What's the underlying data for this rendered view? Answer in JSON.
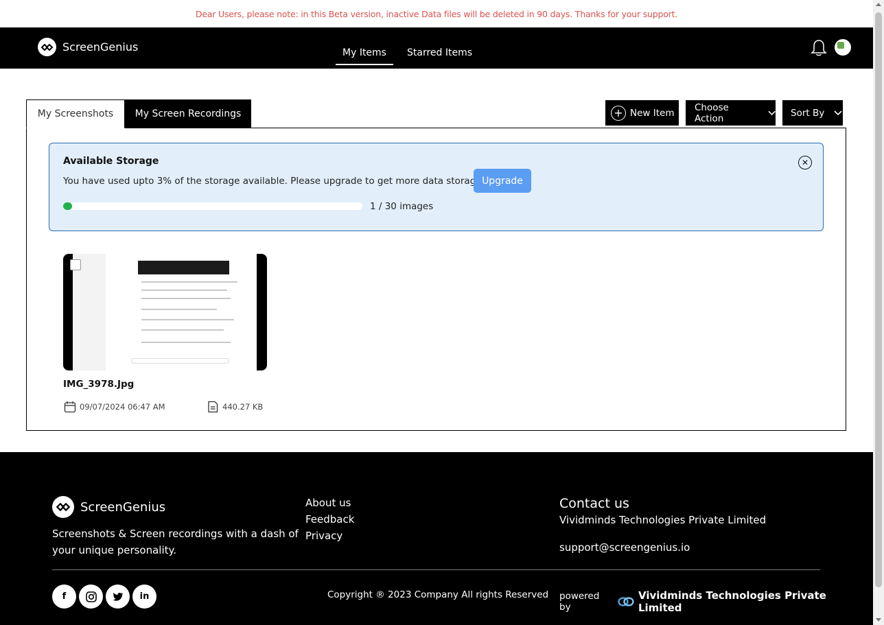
{
  "notice": "Dear Users, please note: in this Beta version, inactive Data files will be deleted in 90 days. Thanks for your support.",
  "header": {
    "brand": "ScreenGenius",
    "tabs": [
      {
        "label": "My Items",
        "active": true
      },
      {
        "label": "Starred Items",
        "active": false
      }
    ],
    "icons": [
      "bell-icon",
      "avatar-image"
    ]
  },
  "content_tabs": [
    {
      "label": "My Screenshots",
      "active": true
    },
    {
      "label": "My Screen Recordings",
      "active": false
    }
  ],
  "toolbar": {
    "new_item": "New Item",
    "choose_action": "Choose Action",
    "sort_by": "Sort By"
  },
  "storage": {
    "title": "Available Storage",
    "message": "You have used upto 3% of the storage available. Please upgrade to get more data storage.",
    "upgrade": "Upgrade",
    "used_fraction": 0.03,
    "count_text": "1 / 30 images",
    "accent": "#22b14c"
  },
  "items": [
    {
      "name": "IMG_3978.Jpg",
      "date": "09/07/2024 06:47 AM",
      "size": "440.27 KB"
    }
  ],
  "footer": {
    "brand": "ScreenGenius",
    "tagline": "Screenshots & Screen recordings with a dash of your unique personality.",
    "links": [
      "About us",
      "Feedback",
      "Privacy"
    ],
    "contact_title": "Contact us",
    "company": "Vividminds Technologies Private Limited",
    "email": "support@screengenius.io",
    "copyright": "Copyright ® 2023 Company All rights Reserved",
    "powered_by": "powered by",
    "powered_company": "Vividminds Technologies Private Limited",
    "socials": [
      "facebook-icon",
      "instagram-icon",
      "twitter-icon",
      "linkedin-icon"
    ]
  }
}
